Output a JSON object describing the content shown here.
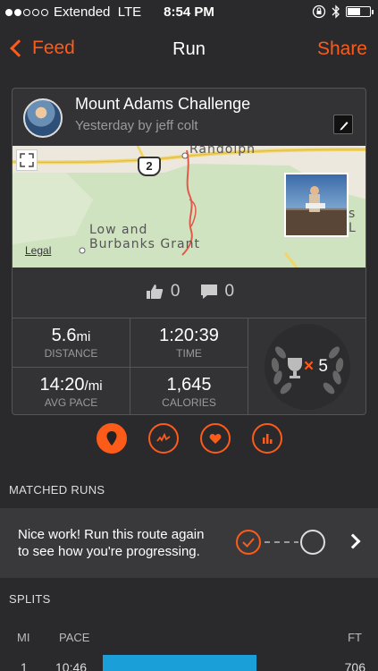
{
  "status_bar": {
    "carrier": "Extended",
    "network": "LTE",
    "time": "8:54 PM"
  },
  "nav": {
    "back_label": "Feed",
    "title": "Run",
    "share_label": "Share"
  },
  "activity": {
    "title": "Mount Adams Challenge",
    "subtitle": "Yesterday by jeff colt",
    "map": {
      "labels": {
        "randolph": "Randolph",
        "route_shield": "2",
        "low_and": "Low and",
        "burbanks": "Burbanks Grant",
        "s_l": "s L"
      },
      "legal": "Legal"
    },
    "kudos": "0",
    "comments": "0",
    "stats": {
      "distance": {
        "value": "5.6",
        "unit": "mi",
        "label": "DISTANCE"
      },
      "time": {
        "value": "1:20:39",
        "label": "TIME"
      },
      "avg_pace": {
        "value": "14:20",
        "unit": "/mi",
        "label": "AVG PACE"
      },
      "calories": {
        "value": "1,645",
        "label": "CALORIES"
      },
      "trophies": {
        "prefix": "×",
        "count": "5"
      }
    }
  },
  "tabs": [
    "map-pin-icon",
    "pace-icon",
    "heart-icon",
    "bar-chart-icon"
  ],
  "matched_runs": {
    "header": "MATCHED RUNS",
    "message_line1": "Nice work! Run this route again",
    "message_line2": "to see how you're progressing."
  },
  "splits": {
    "header": "SPLITS",
    "columns": {
      "mi": "MI",
      "pace": "PACE",
      "ft": "FT"
    },
    "rows": [
      {
        "mi": "1",
        "pace": "10:46",
        "ft": "706"
      }
    ]
  },
  "colors": {
    "accent": "#fc5b1a",
    "bar": "#1a9fd9",
    "background": "#2a2a2c"
  }
}
